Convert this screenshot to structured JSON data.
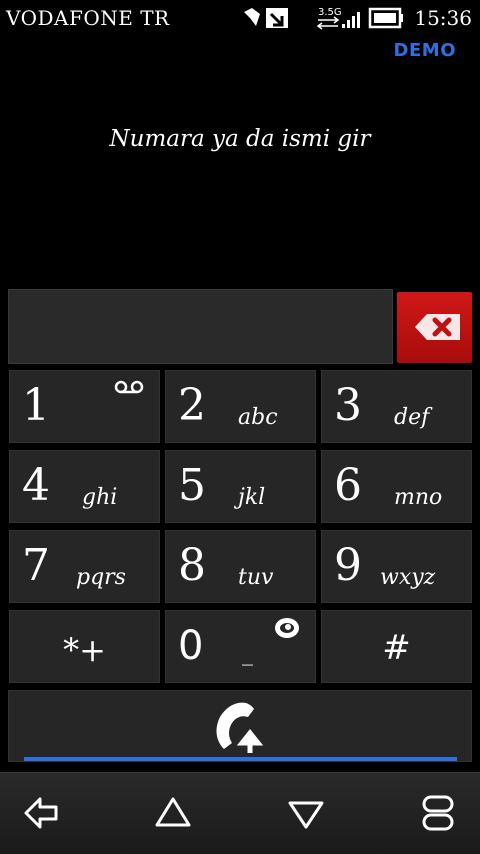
{
  "status_bar": {
    "carrier": "VODAFONE TR",
    "network_label": "3.5G",
    "time": "15:36",
    "icons": [
      "notification-icon",
      "download-icon",
      "network-3.5g-icon",
      "signal-icon",
      "battery-icon"
    ]
  },
  "badge": "DEMO",
  "prompt": "Numara ya da ismi gir",
  "number_input": {
    "value": "",
    "placeholder": ""
  },
  "delete_icon": "backspace-icon",
  "keys": [
    {
      "digit": "1",
      "letters": "",
      "icon": "voicemail-icon"
    },
    {
      "digit": "2",
      "letters": "abc"
    },
    {
      "digit": "3",
      "letters": "def"
    },
    {
      "digit": "4",
      "letters": "ghi"
    },
    {
      "digit": "5",
      "letters": "jkl"
    },
    {
      "digit": "6",
      "letters": "mno"
    },
    {
      "digit": "7",
      "letters": "pqrs"
    },
    {
      "digit": "8",
      "letters": "tuv"
    },
    {
      "digit": "9",
      "letters": "wxyz"
    },
    {
      "digit": "*+",
      "letters": ""
    },
    {
      "digit": "0",
      "letters": "_",
      "icon": "globe-icon"
    },
    {
      "digit": "#",
      "letters": ""
    }
  ],
  "call_icon": "call-icon",
  "navbar": [
    "back-icon",
    "home-icon",
    "menu-down-icon",
    "recent-apps-icon"
  ],
  "colors": {
    "accent": "#2f6fe0",
    "delete": "#c01010",
    "key_bg": "#262626"
  }
}
